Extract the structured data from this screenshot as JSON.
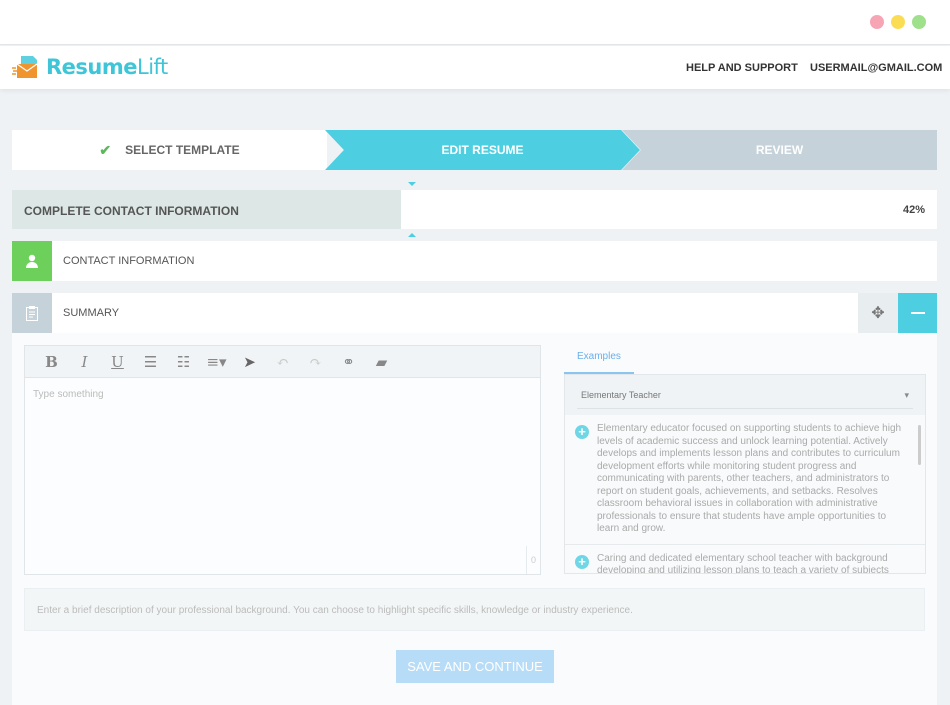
{
  "window": {
    "dots": [
      "#f7a5b5",
      "#fbdd55",
      "#9fe08a"
    ]
  },
  "header": {
    "logo_bold": "Resume",
    "logo_light": "Lift",
    "nav": [
      "HELP AND SUPPORT",
      "USERMAIL@GMAIL.COM"
    ]
  },
  "steps": [
    {
      "label": "SELECT TEMPLATE",
      "done": true
    },
    {
      "label": "EDIT RESUME",
      "active": true
    },
    {
      "label": "REVIEW"
    }
  ],
  "progress": {
    "label": "COMPLETE CONTACT INFORMATION",
    "value": 42,
    "value_text": "42%"
  },
  "sections": [
    {
      "label": "CONTACT INFORMATION",
      "icon": "user-icon",
      "color": "#6dd05a"
    },
    {
      "label": "SUMMARY",
      "icon": "clipboard-icon",
      "color": "#c5d2da"
    }
  ],
  "editor": {
    "placeholder": "Type something",
    "counter": "0",
    "toolbar": [
      "bold",
      "italic",
      "underline",
      "bullet-list",
      "numbered-list",
      "align",
      "pointer",
      "undo",
      "redo",
      "link",
      "eraser"
    ]
  },
  "examples": {
    "tab": "Examples",
    "selected": "Elementary Teacher",
    "items": [
      "Elementary educator focused on supporting students to achieve high levels of academic success and unlock learning potential. Actively develops and implements lesson plans and contributes to curriculum development efforts while monitoring student progress and communicating with parents, other teachers, and administrators to report on student goals, achievements, and setbacks. Resolves classroom behavioral issues in collaboration with administrative professionals to ensure that students have ample opportunities to learn and grow.",
      "Caring and dedicated elementary school teacher with background developing and utilizing lesson plans to teach a variety of subjects"
    ]
  },
  "description": "Enter a brief description of your professional background. You can choose to highlight specific skills, knowledge or industry experience.",
  "save_label": "SAVE AND CONTINUE",
  "accent": "#4ecfe1"
}
